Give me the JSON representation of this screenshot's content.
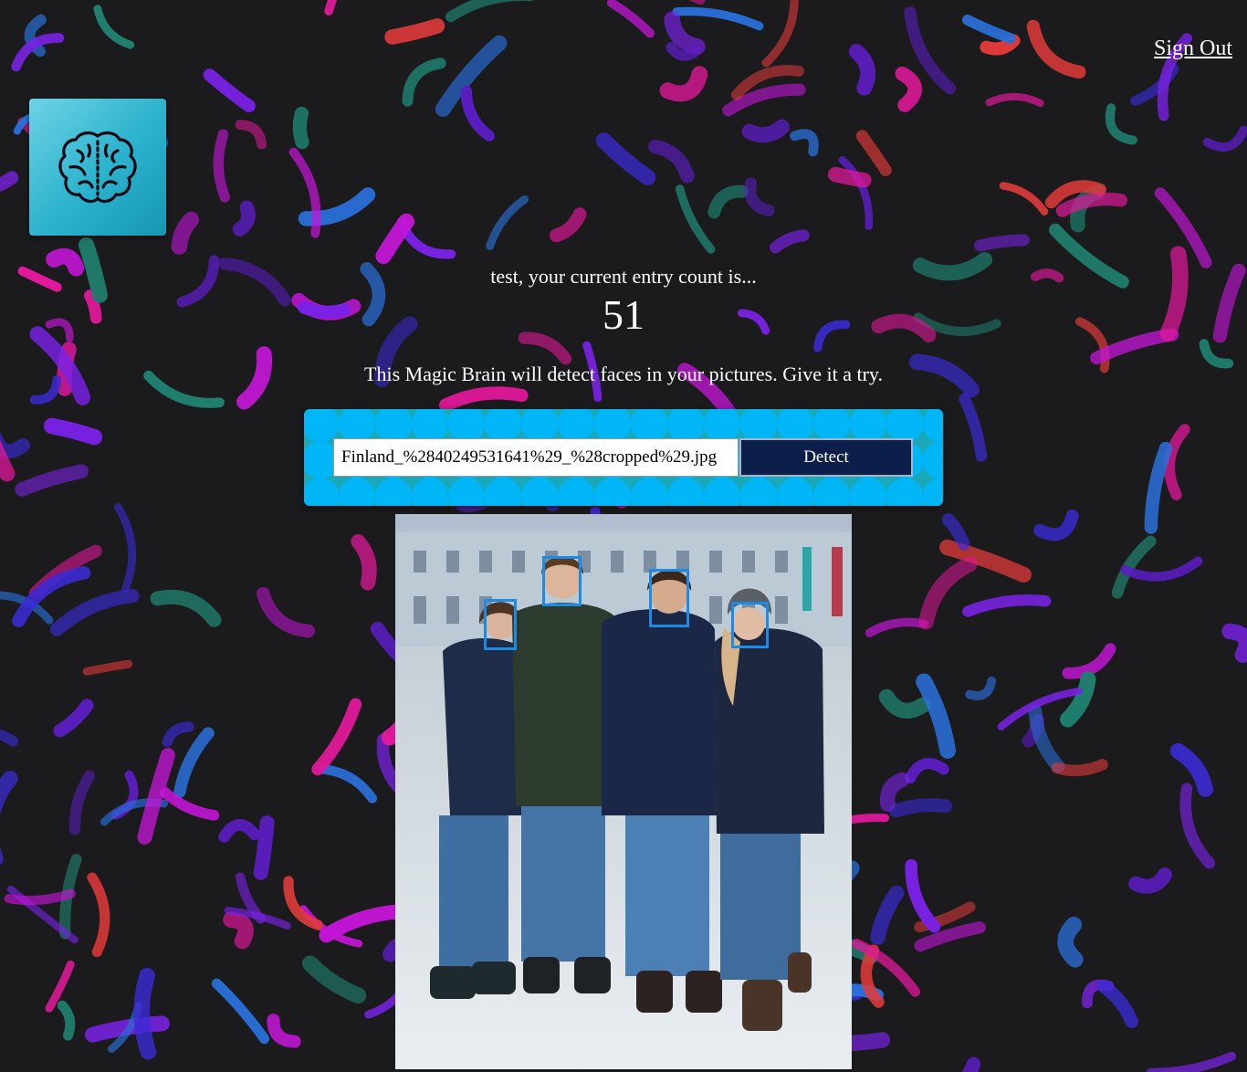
{
  "nav": {
    "sign_out_label": "Sign Out"
  },
  "logo": {
    "icon": "brain-icon",
    "gradient": [
      "#6ed3e6",
      "#1697b2"
    ]
  },
  "rank": {
    "label": "test, your current entry count is...",
    "count": "51"
  },
  "intro": {
    "text": "This Magic Brain will detect faces in your pictures. Give it a try."
  },
  "form": {
    "url_value": "Finland_%2840249531641%29_%28cropped%29.jpg",
    "detect_label": "Detect"
  },
  "result": {
    "faces_detected": 4,
    "box_color": "#1c8be6"
  },
  "colors": {
    "background": "#1b1b1d",
    "panel_teal": "#1aa7b8",
    "panel_circles": "#00b6f6",
    "button": "#0c1f4b"
  }
}
